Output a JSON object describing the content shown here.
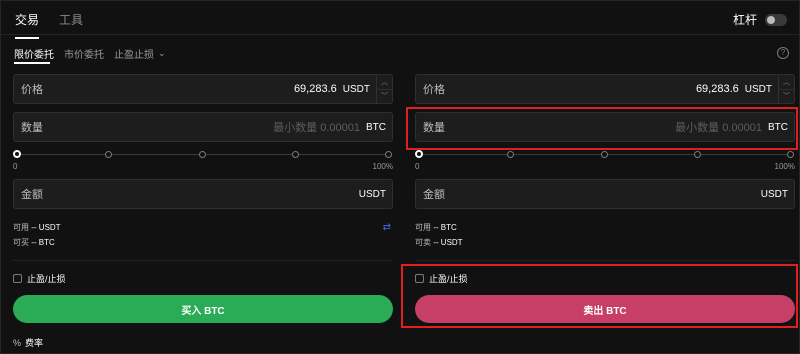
{
  "header": {
    "tabs": [
      {
        "label": "交易"
      },
      {
        "label": "工具"
      }
    ],
    "leverage_label": "杠杆"
  },
  "order_tabs": [
    {
      "label": "限价委托"
    },
    {
      "label": "市价委托"
    },
    {
      "label": "止盈止损"
    }
  ],
  "help": "?",
  "buy": {
    "price_label": "价格",
    "price_value": "69,283.6",
    "price_unit": "USDT",
    "qty_label": "数量",
    "qty_placeholder": "最小数量 0.00001",
    "qty_unit": "BTC",
    "slider_min": "0",
    "slider_max": "100%",
    "amount_label": "金额",
    "amount_unit": "USDT",
    "avail_line1": {
      "label": "可用",
      "value": "-- USDT"
    },
    "avail_line2": {
      "label": "可买",
      "value": "-- BTC"
    },
    "tpsl_label": "止盈/止损",
    "button_label": "买入 BTC",
    "fee_label": "费率"
  },
  "sell": {
    "price_label": "价格",
    "price_value": "69,283.6",
    "price_unit": "USDT",
    "qty_label": "数量",
    "qty_placeholder": "最小数量 0.00001",
    "qty_unit": "BTC",
    "slider_min": "0",
    "slider_max": "100%",
    "amount_label": "金额",
    "amount_unit": "USDT",
    "avail_line1": {
      "label": "可用",
      "value": "-- BTC"
    },
    "avail_line2": {
      "label": "可卖",
      "value": "-- USDT"
    },
    "tpsl_label": "止盈/止损",
    "button_label": "卖出 BTC"
  },
  "colors": {
    "buy": "#2aab56",
    "sell": "#c73e66",
    "highlight": "#e02020",
    "accent": "#3d6cf0"
  }
}
